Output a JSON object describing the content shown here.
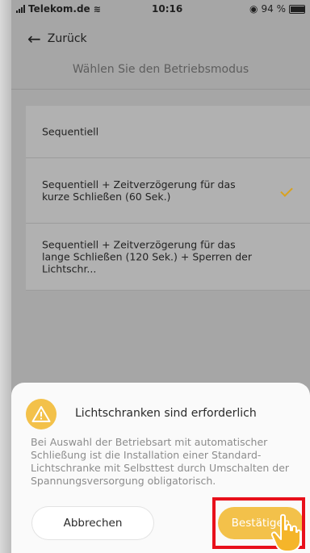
{
  "status_bar": {
    "carrier": "Telekom.de",
    "time": "10:16",
    "battery": "94 %",
    "battery_level": 0.94
  },
  "header": {
    "back_label": "Zurück",
    "title": "Wählen Sie den Betriebsmodus"
  },
  "options": [
    {
      "label": "Sequentiell",
      "selected": false
    },
    {
      "label": "Sequentiell + Zeitverzögerung für das kurze Schließen (60 Sek.)",
      "selected": true
    },
    {
      "label": "Sequentiell + Zeitverzögerung für das lange Schließen (120 Sek.) + Sperren der Lichtschr...",
      "selected": false
    }
  ],
  "dialog": {
    "icon": "warning-icon",
    "title": "Lichtschranken sind erforderlich",
    "message": "Bei Auswahl der Betriebsart mit automatischer Schließung ist die Installation einer Standard-Lichtschranke mit Selbsttest durch Umschalten der Spannungsversorgung obligatorisch.",
    "cancel_label": "Abbrechen",
    "confirm_label": "Bestätigen"
  },
  "colors": {
    "accent": "#f3c14a",
    "checkmark": "#d9a21e",
    "highlight": "#e8101b"
  }
}
